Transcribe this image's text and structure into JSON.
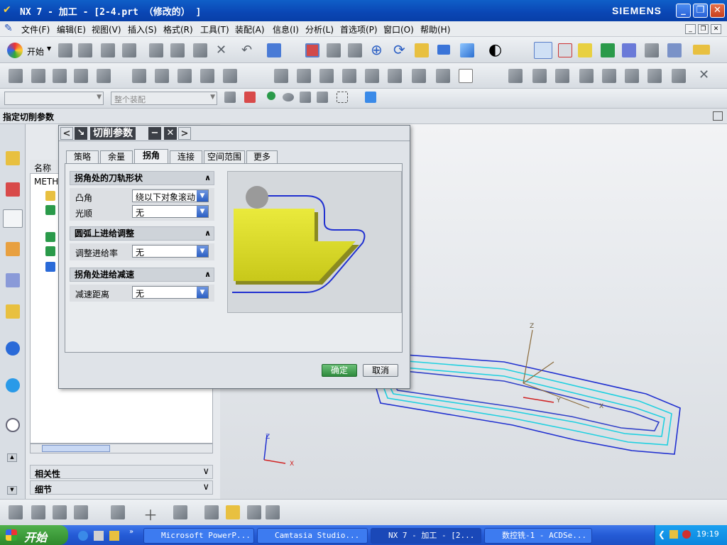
{
  "window": {
    "title": "NX 7 - 加工 - [2-4.prt （修改的） ]",
    "brand": "SIEMENS"
  },
  "menubar": {
    "items": [
      "文件(F)",
      "编辑(E)",
      "视图(V)",
      "插入(S)",
      "格式(R)",
      "工具(T)",
      "装配(A)",
      "信息(I)",
      "分析(L)",
      "首选项(P)",
      "窗口(O)",
      "帮助(H)"
    ]
  },
  "toolbar": {
    "start_label": "开始",
    "filter_placeholder": "",
    "assembly_combo": "整个装配"
  },
  "status": {
    "prompt": "指定切削参数"
  },
  "navigator": {
    "column_name": "名称",
    "row_method": "METH",
    "section_dependencies": "相关性",
    "section_details": "细节"
  },
  "dialog": {
    "title": "切削参数",
    "tabs": [
      "策略",
      "余量",
      "拐角",
      "连接",
      "空间范围",
      "更多"
    ],
    "active_tab": "拐角",
    "groups": [
      {
        "title": "拐角处的刀轨形状",
        "rows": [
          {
            "label": "凸角",
            "value": "绕以下对象滚动"
          },
          {
            "label": "光顺",
            "value": "无"
          }
        ]
      },
      {
        "title": "圆弧上进给调整",
        "rows": [
          {
            "label": "调整进给率",
            "value": "无"
          }
        ]
      },
      {
        "title": "拐角处进给减速",
        "rows": [
          {
            "label": "减速距离",
            "value": "无"
          }
        ]
      }
    ],
    "ok_label": "确定",
    "cancel_label": "取消"
  },
  "viewport": {
    "axis_x": "X",
    "axis_y": "Y",
    "axis_z": "Z",
    "triad_x": "X",
    "triad_z": "Z"
  },
  "taskbar": {
    "start": "开始",
    "tasks": [
      "Microsoft PowerP...",
      "Camtasia Studio...",
      "NX 7 - 加工 - [2...",
      "数控铣-1 - ACDSe..."
    ],
    "clock": "19:19"
  },
  "colors": {
    "accent": "#245bd6",
    "part_yellow": "#dede2a",
    "toolpath_blue": "#2030d0",
    "toolpath_cyan": "#20d0e0"
  }
}
